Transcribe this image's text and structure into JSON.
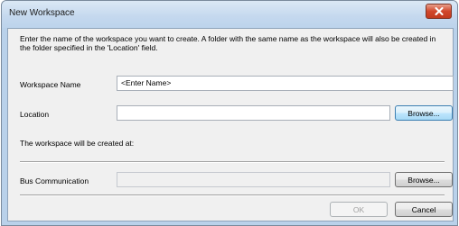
{
  "window": {
    "title": "New Workspace"
  },
  "intro_text": "Enter the name of the workspace you want to create. A folder with the same name as the workspace will also be created in the folder specified in the 'Location' field.",
  "workspace_name": {
    "label": "Workspace Name",
    "value": "<Enter Name>"
  },
  "location": {
    "label": "Location",
    "value": "",
    "browse_label": "Browse..."
  },
  "created_at_text": "The workspace will be created at:",
  "bus_communication": {
    "label": "Bus Communication",
    "value": "",
    "browse_label": "Browse..."
  },
  "footer": {
    "ok_label": "OK",
    "cancel_label": "Cancel"
  },
  "icons": {
    "close": "close-icon"
  }
}
